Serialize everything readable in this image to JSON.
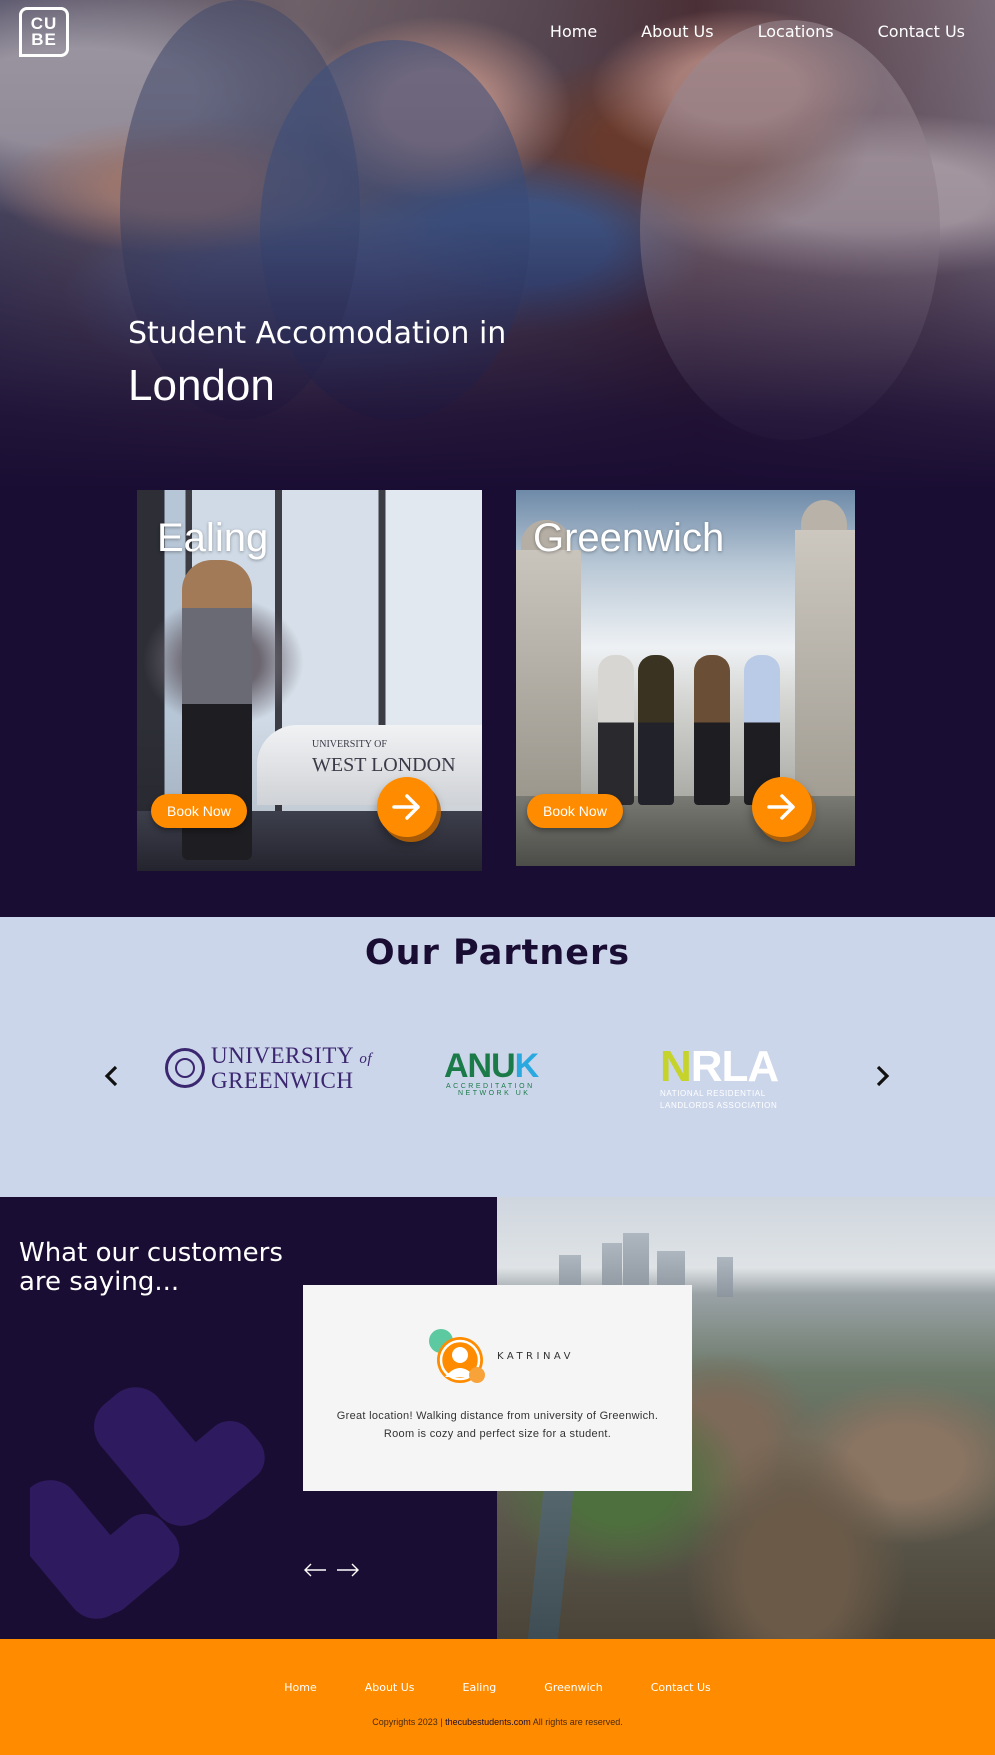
{
  "brand": {
    "logo_line1": "CU",
    "logo_line2": "BE"
  },
  "nav": {
    "items": [
      "Home",
      "About Us",
      "Locations",
      "Contact Us"
    ]
  },
  "hero": {
    "subtitle": "Student Accomodation in",
    "city": "London"
  },
  "locations": [
    {
      "name": "Ealing",
      "button": "Book Now",
      "sign_small": "UNIVERSITY OF",
      "sign_big": "WEST LONDON"
    },
    {
      "name": "Greenwich",
      "button": "Book Now"
    }
  ],
  "partners": {
    "title": "Our Partners",
    "logos": [
      {
        "name_line1": "UNIVERSITY",
        "name_of": "of",
        "name_line2": "GREENWICH"
      },
      {
        "name_main": "ANU",
        "name_accent": "K",
        "sub1": "ACCREDITATION",
        "sub2": "NETWORK UK"
      },
      {
        "name_accent": "N",
        "name_main": "RLA",
        "sub1": "NATIONAL RESIDENTIAL",
        "sub2": "LANDLORDS ASSOCIATION"
      }
    ]
  },
  "testimonials": {
    "title_line1": "What our customers",
    "title_line2": "are saying...",
    "reviewer": "KATRINAV",
    "text_line1": "Great location! Walking distance from university of Greenwich.",
    "text_line2": "Room is cozy and perfect size for a student."
  },
  "footer": {
    "links": [
      "Home",
      "About Us",
      "Ealing",
      "Greenwich",
      "Contact Us"
    ],
    "copy_prefix": "Copyrights 2023 | ",
    "copy_site": "thecubestudents.com",
    "copy_suffix": " All rights are reserved."
  },
  "colors": {
    "primary": "#1a0d33",
    "accent": "#ff8c00",
    "partners_bg": "#ccd6ea",
    "card_bg": "#f5f5f5"
  },
  "icons": [
    "arrow-right-icon",
    "chevron-left-icon",
    "chevron-right-icon",
    "quote-icon",
    "user-avatar-icon",
    "arrow-left-line-icon",
    "arrow-right-line-icon"
  ]
}
